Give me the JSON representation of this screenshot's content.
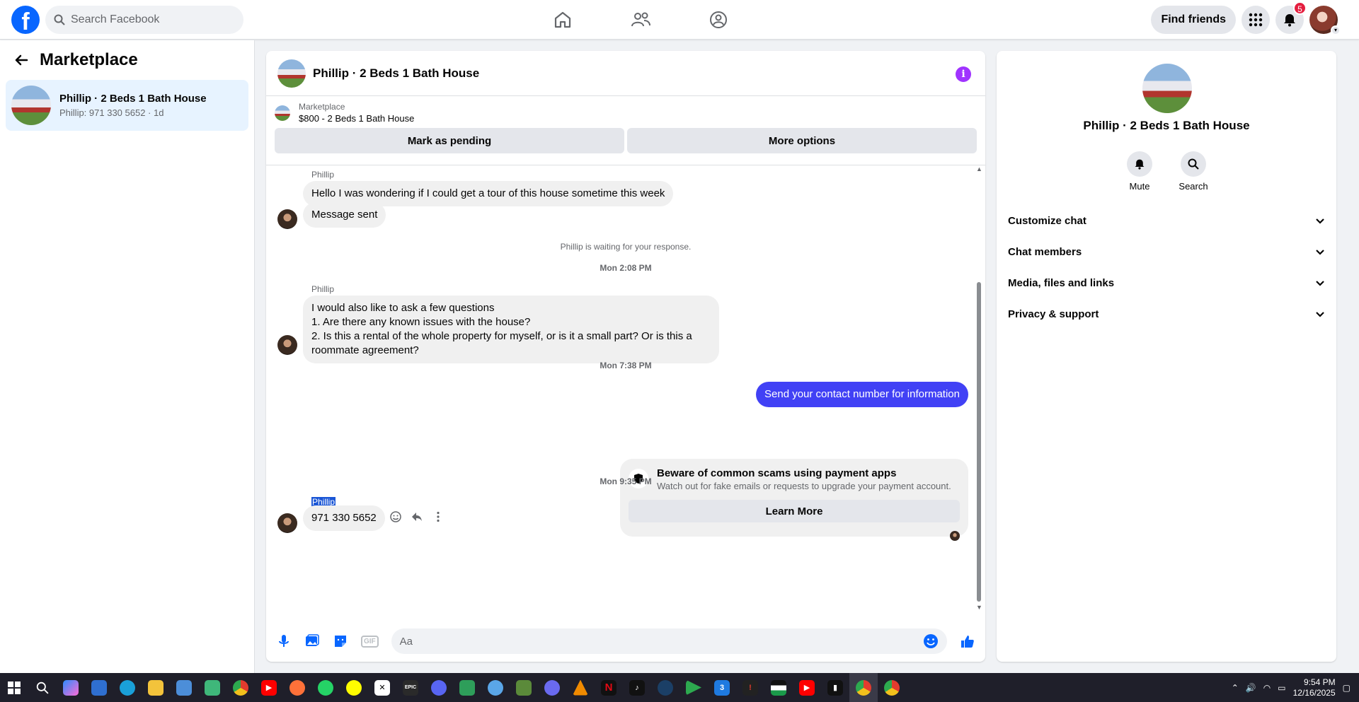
{
  "header": {
    "search_placeholder": "Search Facebook",
    "find_friends": "Find friends",
    "notification_count": "5"
  },
  "sidebar": {
    "title": "Marketplace",
    "thread": {
      "name": "Phillip · 2 Beds 1 Bath House",
      "subtitle": "Phillip: 971 330 5652 · 1d"
    }
  },
  "chat": {
    "title": "Phillip · 2 Beds 1 Bath House",
    "listing_label": "Marketplace",
    "listing_value": "$800 - 2 Beds 1 Bath House",
    "mark_pending": "Mark as pending",
    "more_options": "More options",
    "messages": {
      "sender1": "Phillip",
      "m1": "Hello I was wondering if I could get a tour of this house sometime this week",
      "m2": "Message sent",
      "waiting": "Phillip is waiting for your response.",
      "time1": "Mon 2:08 PM",
      "sender2": "Phillip",
      "m3_l1": "I would also like to ask a few questions",
      "m3_l2": "1. Are there any known issues with the house?",
      "m3_l3": "2. Is this a rental of the whole property for myself, or is it a small part? Or is this a",
      "m3_l4": "roommate agreement?",
      "time2": "Mon 7:38 PM",
      "out1": "Send your contact number for information",
      "scam_title": "Beware of common scams using payment apps",
      "scam_body": "Watch out for fake emails or requests to upgrade your payment account.",
      "learn_more": "Learn More",
      "time3": "Mon 9:35 PM",
      "sender3": "Phillip",
      "m4": "971 330 5652"
    },
    "composer_placeholder": "Aa"
  },
  "right_panel": {
    "name": "Phillip · 2 Beds 1 Bath House",
    "mute": "Mute",
    "search": "Search",
    "sections": [
      "Customize chat",
      "Chat members",
      "Media, files and links",
      "Privacy & support"
    ]
  },
  "taskbar": {
    "time": "9:54 PM",
    "date": "12/16/2025"
  },
  "colors": {
    "brand": "#0866ff",
    "outgoing_bubble": "#4141f5",
    "info": "#a033ff",
    "badge": "#e41e3f"
  }
}
